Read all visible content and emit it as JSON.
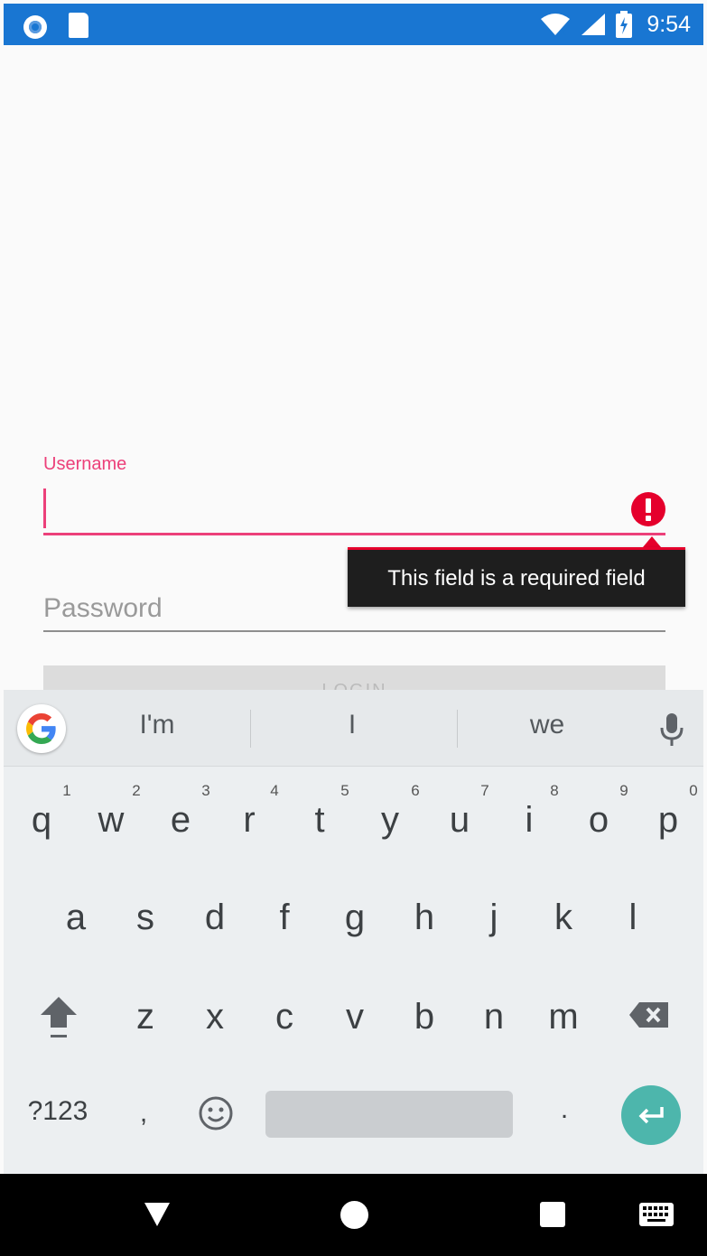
{
  "status_bar": {
    "time": "9:54",
    "background": "#1976d2"
  },
  "form": {
    "username_label": "Username",
    "username_value": "",
    "error_tooltip": "This field is a required field",
    "password_placeholder": "Password",
    "login_label": "LOGIN"
  },
  "keyboard": {
    "suggestions": [
      "I'm",
      "I",
      "we"
    ],
    "row1": [
      {
        "letter": "q",
        "hint": "1"
      },
      {
        "letter": "w",
        "hint": "2"
      },
      {
        "letter": "e",
        "hint": "3"
      },
      {
        "letter": "r",
        "hint": "4"
      },
      {
        "letter": "t",
        "hint": "5"
      },
      {
        "letter": "y",
        "hint": "6"
      },
      {
        "letter": "u",
        "hint": "7"
      },
      {
        "letter": "i",
        "hint": "8"
      },
      {
        "letter": "o",
        "hint": "9"
      },
      {
        "letter": "p",
        "hint": "0"
      }
    ],
    "row2": [
      "a",
      "s",
      "d",
      "f",
      "g",
      "h",
      "j",
      "k",
      "l"
    ],
    "row3": [
      "z",
      "x",
      "c",
      "v",
      "b",
      "n",
      "m"
    ],
    "symbols_label": "?123",
    "comma": ",",
    "period": "."
  },
  "colors": {
    "accent": "#ec407a",
    "error": "#e5002c",
    "enter": "#4db6ac"
  }
}
